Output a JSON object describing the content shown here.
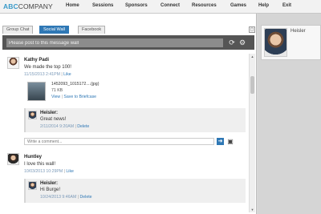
{
  "brand": {
    "prefix": "ABC",
    "suffix": "COMPANY"
  },
  "nav": [
    "Home",
    "Sessions",
    "Sponsors",
    "Connect",
    "Resources",
    "Games",
    "Help",
    "Exit"
  ],
  "tabs": [
    "Group Chat",
    "Social Wall",
    "Facebook"
  ],
  "active_tab": "Social Wall",
  "post": {
    "placeholder": "Please post to this message wall"
  },
  "feed": {
    "post1": {
      "author": "Kathy Padi",
      "text": "We made the top 100!",
      "timestamp": "11/15/2013 2:41PM",
      "like": "Like",
      "attachment": {
        "filename": "1452093_1015172....(jpg)",
        "size": "71 KB",
        "view": "View",
        "save": "Save to Briefcase"
      },
      "comment": {
        "author": "Heisler:",
        "text": "Great news!",
        "timestamp": "2/11/2014 9:20AM",
        "delete": "Delete"
      },
      "comment_placeholder": "Write a comment..."
    },
    "post2": {
      "author": "Huntley",
      "text": "I love this wall!",
      "timestamp": "10/03/2013 10:29PM",
      "like": "Like",
      "comment": {
        "author": "Heisler:",
        "text": "Hi Burge!",
        "timestamp": "10/24/2013 9:46AM",
        "delete": "Delete"
      }
    }
  },
  "profile": {
    "name": "Heisler"
  },
  "icons": {
    "refresh": "refresh-icon",
    "settings": "gear-icon",
    "send": "arrow-right-icon",
    "save": "floppy-disk-icon"
  }
}
